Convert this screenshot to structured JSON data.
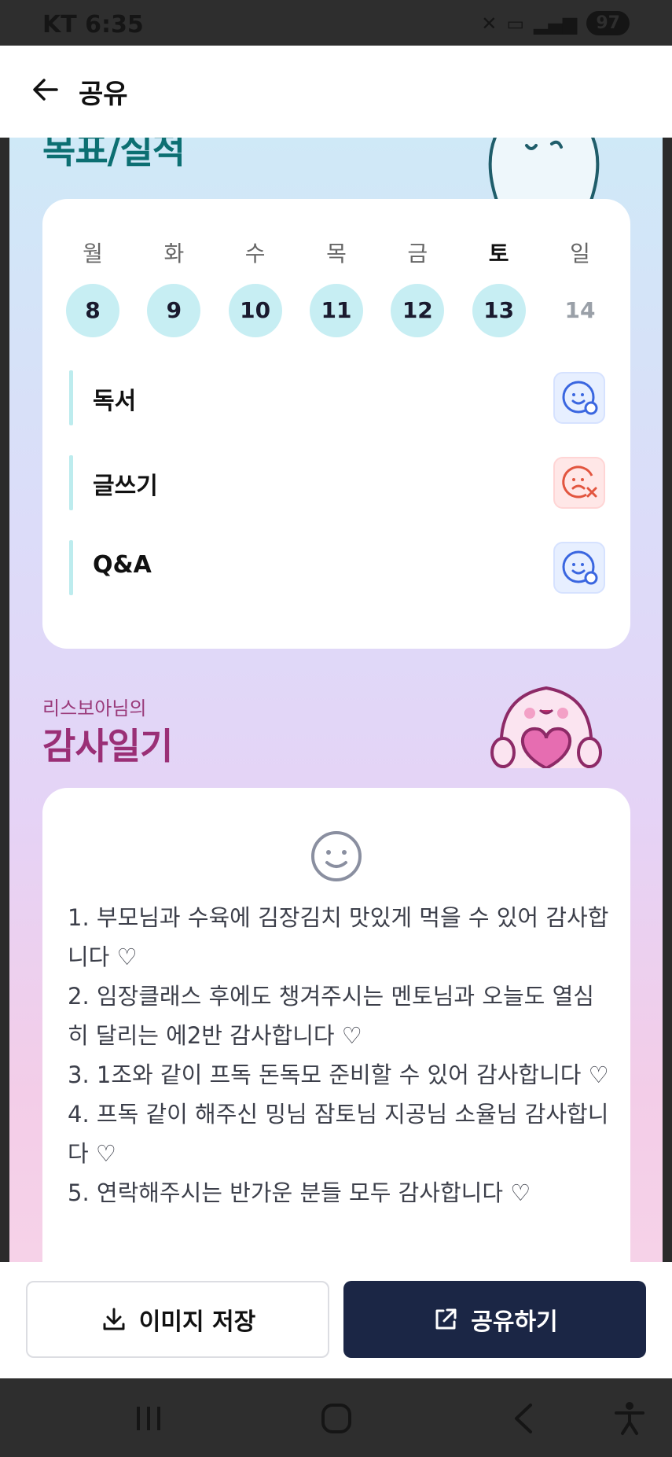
{
  "status_bar": {
    "carrier_time": "KT 6:35",
    "battery": "97"
  },
  "header": {
    "title": "공유"
  },
  "goals_section": {
    "title": "목표/실적",
    "days": [
      {
        "dow": "월",
        "date": "8",
        "checked": true
      },
      {
        "dow": "화",
        "date": "9",
        "checked": true
      },
      {
        "dow": "수",
        "date": "10",
        "checked": true
      },
      {
        "dow": "목",
        "date": "11",
        "checked": true
      },
      {
        "dow": "금",
        "date": "12",
        "checked": true
      },
      {
        "dow": "토",
        "date": "13",
        "checked": true
      },
      {
        "dow": "일",
        "date": "14",
        "checked": false
      }
    ],
    "goals": [
      {
        "name": "독서",
        "status": "done",
        "icon": "happy-check-icon",
        "color": "#3a66e0"
      },
      {
        "name": "글쓰기",
        "status": "fail",
        "icon": "sad-x-icon",
        "color": "#e2553f"
      },
      {
        "name": "Q&A",
        "status": "done",
        "icon": "happy-check-icon",
        "color": "#3a66e0"
      }
    ]
  },
  "gratitude_section": {
    "subtitle": "리스보아님의",
    "title": "감사일기",
    "mood_icon": "smiley-icon",
    "text": "1. 부모님과 수육에 김장김치 맛있게 먹을 수 있어 감사합니다 ♡\n2. 임장클래스 후에도 챙겨주시는 멘토님과 오늘도 열심히 달리는 에2반 감사합니다 ♡\n3. 1조와 같이 프독 돈독모 준비할 수 있어 감사합니다 ♡\n4. 프독 같이 해주신 밍님 잠토님 지공님 소율님 감사합니다 ♡\n5. 연락해주시는 반가운 분들 모두 감사합니다 ♡"
  },
  "actions": {
    "save_label": "이미지 저장",
    "share_label": "공유하기"
  },
  "colors": {
    "primary": "#1b2645",
    "teal_title": "#0c6f72",
    "magenta_title": "#9a2f76",
    "date_fill": "#c7eef3"
  }
}
